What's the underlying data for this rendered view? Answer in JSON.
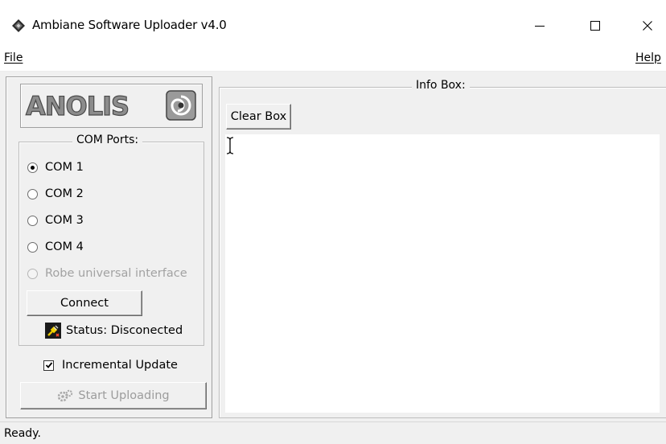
{
  "window": {
    "title": "Ambiane Software Uploader v4.0",
    "icon": "app-diamond-icon",
    "controls": {
      "minimize": "minimize-icon",
      "maximize": "maximize-icon",
      "close": "close-icon"
    }
  },
  "menu": {
    "file": "File",
    "help": "Help"
  },
  "logo": {
    "text": "ANOLIS"
  },
  "com_ports": {
    "legend": "COM Ports:",
    "options": [
      {
        "label": "COM 1",
        "checked": true,
        "enabled": true
      },
      {
        "label": "COM 2",
        "checked": false,
        "enabled": true
      },
      {
        "label": "COM 3",
        "checked": false,
        "enabled": true
      },
      {
        "label": "COM 4",
        "checked": false,
        "enabled": true
      },
      {
        "label": "Robe universal interface",
        "checked": false,
        "enabled": false
      }
    ],
    "connect_label": "Connect",
    "status_text": "Status: Disconected",
    "status_icon": "disconnected-plug-icon"
  },
  "incremental": {
    "label": "Incremental Update",
    "checked": true
  },
  "upload": {
    "label": "Start Uploading",
    "enabled": false,
    "icon": "upload-gears-icon"
  },
  "info_box": {
    "legend": "Info Box:",
    "clear_label": "Clear Box",
    "content": ""
  },
  "statusbar": {
    "text": "Ready."
  }
}
